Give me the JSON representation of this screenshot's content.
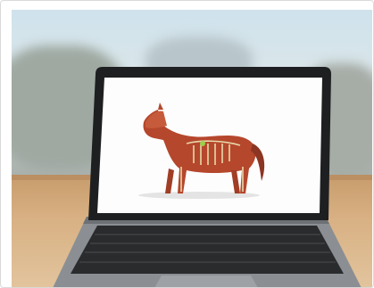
{
  "image": {
    "subject": "laptop-on-wooden-table",
    "screen_content": "horse-anatomy-illustration"
  },
  "colors": {
    "sky": "#cfe2ec",
    "table": "#d8b184",
    "laptop_body": "#8a8e92",
    "bezel": "#1e1f21",
    "screen_bg": "#fdfdfd",
    "horse_muscle": "#b5472c",
    "horse_bone": "#e7d9a9"
  }
}
